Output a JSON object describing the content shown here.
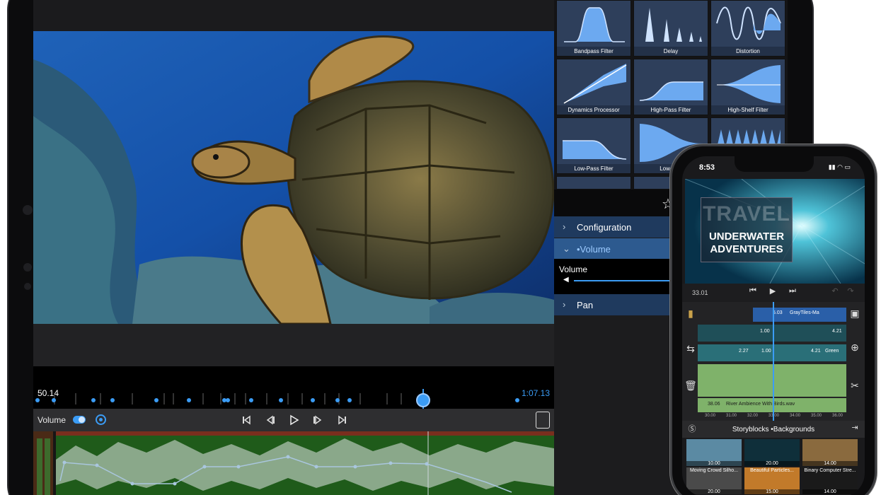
{
  "editor": {
    "timeline_start": "50.14",
    "timeline_end": "1:07.13",
    "volume_label": "Volume"
  },
  "effects": {
    "items": [
      {
        "label": "Bandpass Filter"
      },
      {
        "label": "Delay"
      },
      {
        "label": "Distortion"
      },
      {
        "label": "Dynamics Processor"
      },
      {
        "label": "High-Pass Filter"
      },
      {
        "label": "High-Shelf Filter"
      },
      {
        "label": "Low-Pass Filter"
      },
      {
        "label": "Low-She"
      }
    ]
  },
  "inspector": {
    "configuration": "Configuration",
    "volume_section": "•Volume",
    "volume_label": "Volume",
    "pan": "Pan"
  },
  "phone": {
    "time": "8:53",
    "title_ghost": "TRAVEL",
    "title_line1": "UNDERWATER",
    "title_line2": "ADVENTURES",
    "playhead_time": "33.01",
    "clip_a": "5.03",
    "clip_a_name": "GrayTiles-Ma",
    "clip_b": "1.00",
    "clip_c": "4.21",
    "clip_d": "2.27",
    "clip_e": "1.00",
    "clip_f": "4.21",
    "clip_f_name": "Green",
    "audio_time": "38.06",
    "audio_name": "River Ambience With Birds.wav",
    "ruler": [
      "30.00",
      "31.00",
      "32.00",
      "33.00",
      "34.00",
      "35.00",
      "36.00"
    ],
    "library_title": "Storyblocks •Backgrounds",
    "thumbs": [
      {
        "dur": "10.00",
        "label": ""
      },
      {
        "dur": "20.00",
        "label": ""
      },
      {
        "dur": "14.00",
        "label": ""
      },
      {
        "dur": "20.00",
        "label": "Moving Crowd Silho..."
      },
      {
        "dur": "15.00",
        "label": "Beautiful Particles..."
      },
      {
        "dur": "14.00",
        "label": "Binary Computer Stre..."
      }
    ]
  },
  "colors": {
    "accent": "#3b9cf5",
    "panel_blue": "#2e3f5b",
    "row_blue": "#1f3a5e",
    "audio_green": "#7fb26a"
  }
}
